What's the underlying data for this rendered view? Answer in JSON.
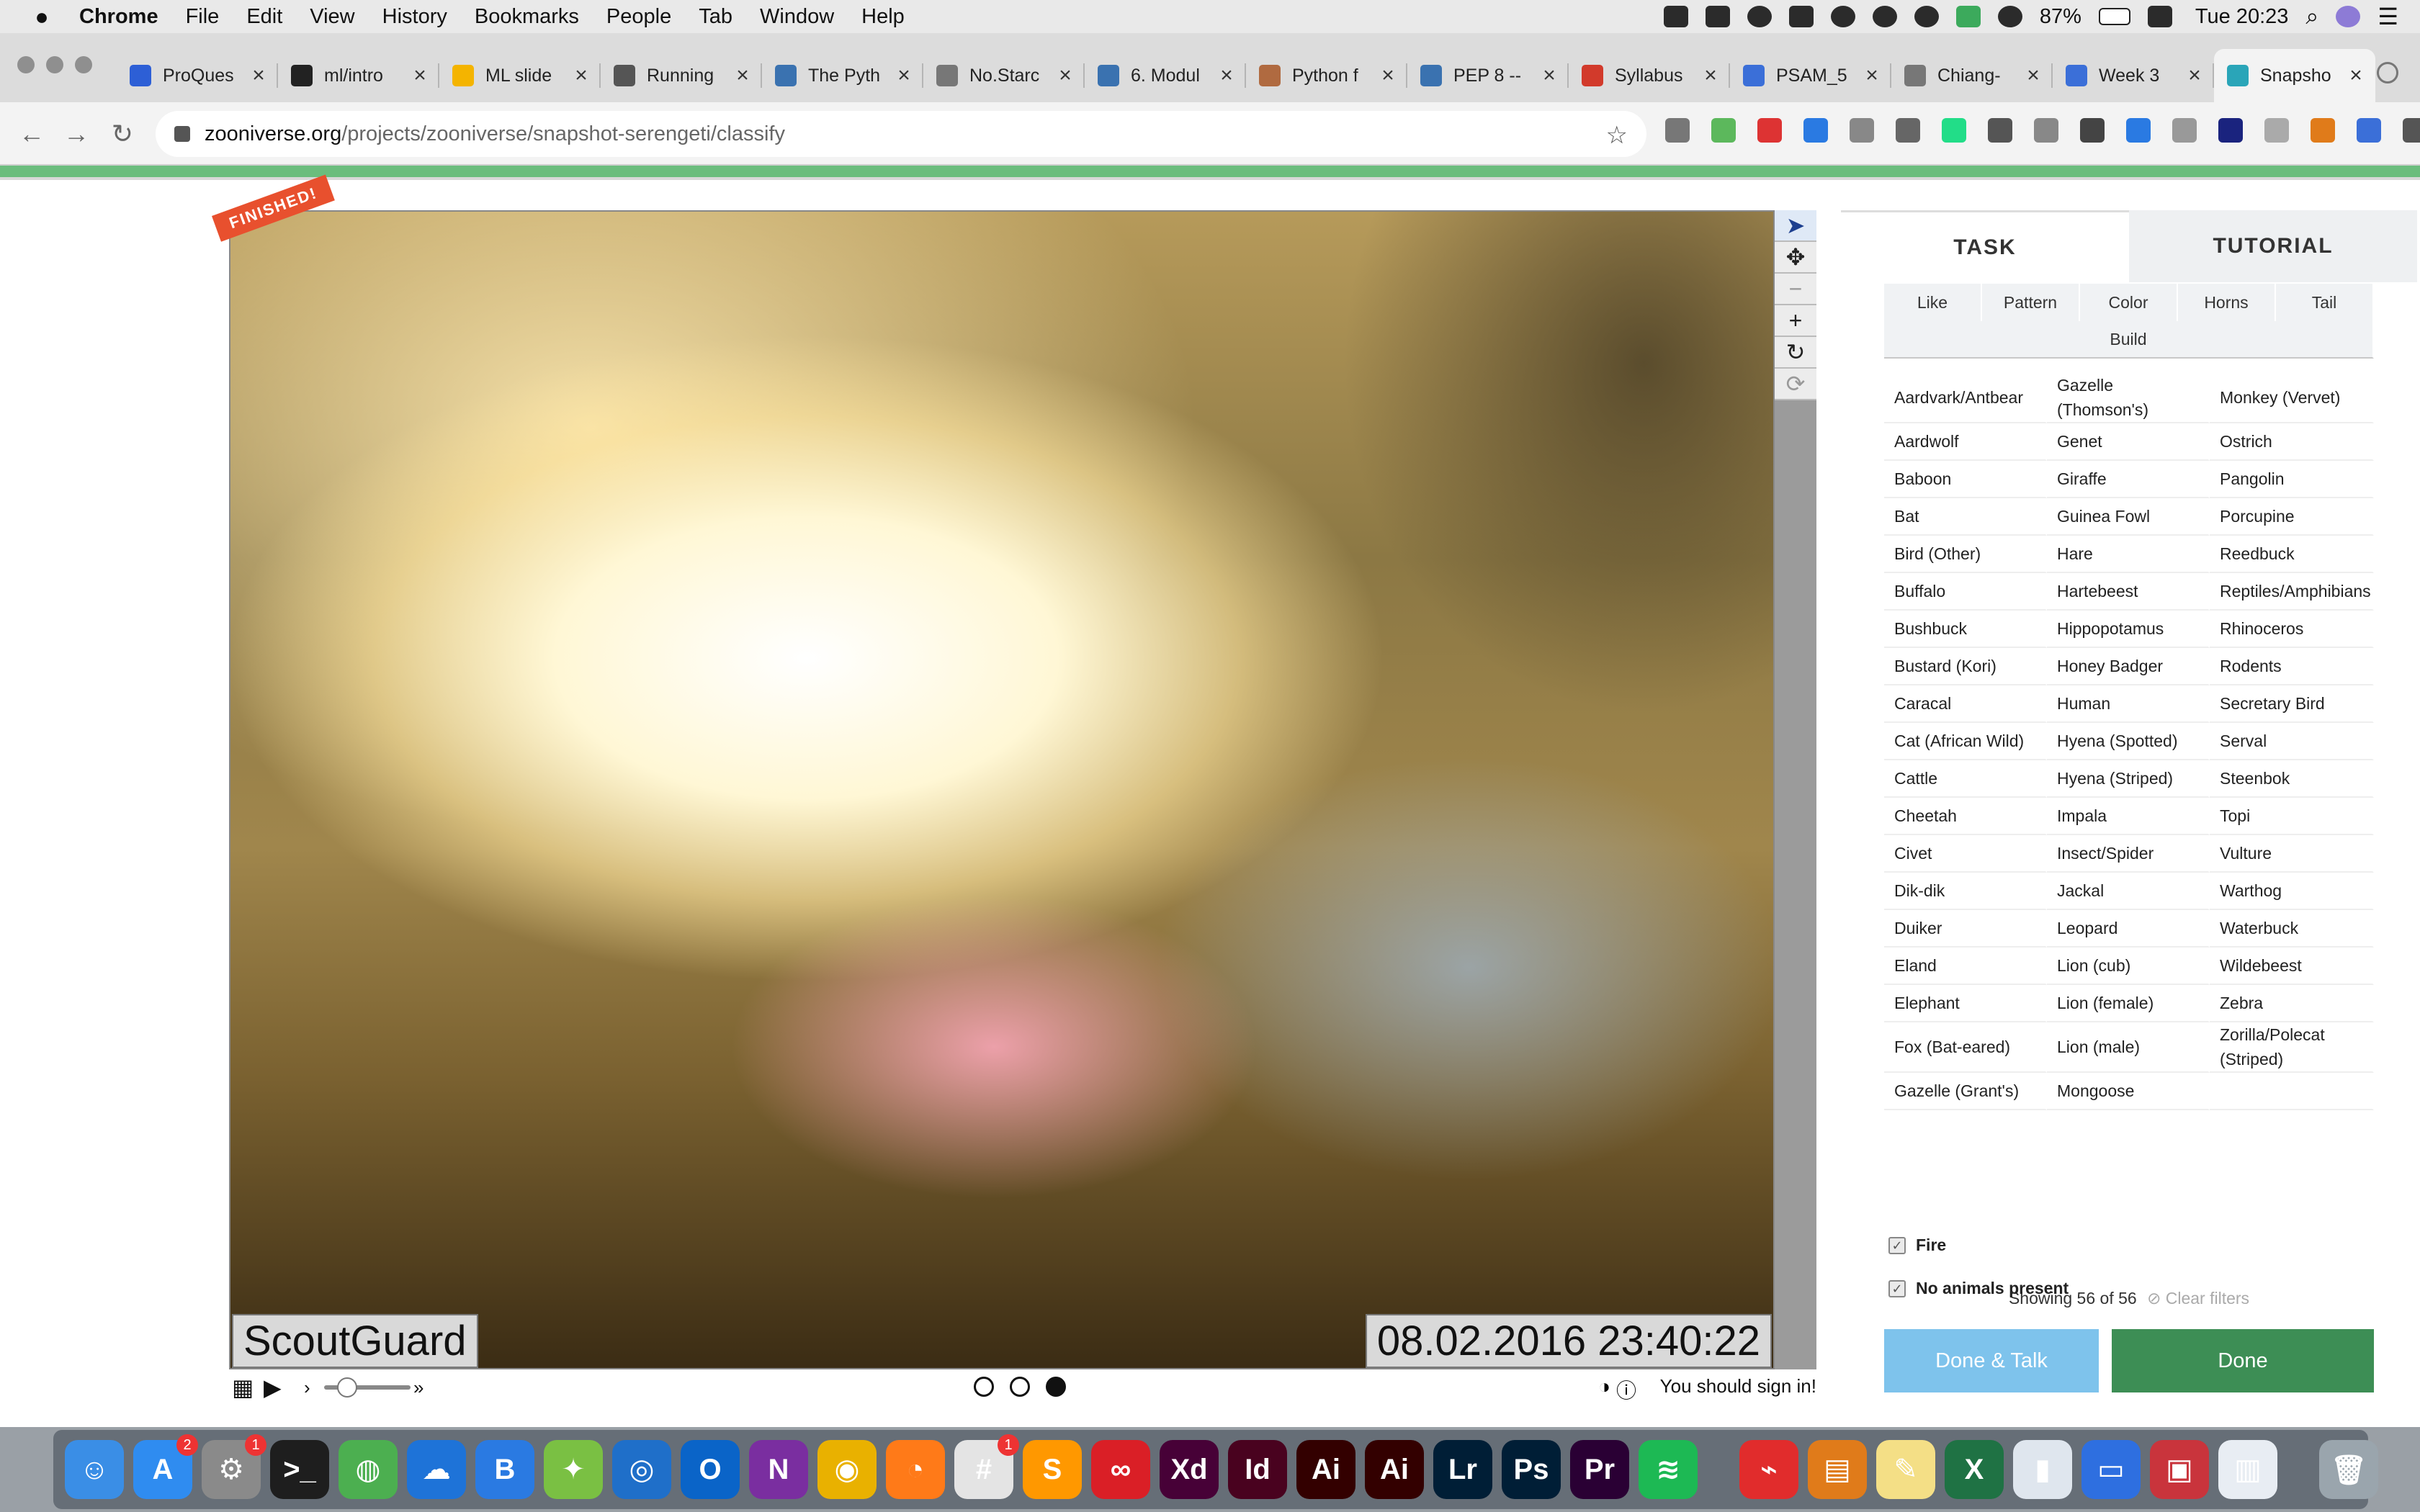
{
  "menubar": {
    "app": "Chrome",
    "items": [
      "File",
      "Edit",
      "View",
      "History",
      "Bookmarks",
      "People",
      "Tab",
      "Window",
      "Help"
    ],
    "battery": "87%",
    "clock": "Tue 20:23"
  },
  "tabs": [
    {
      "label": "ProQues",
      "color": "#2d5fd6"
    },
    {
      "label": "ml/intro",
      "color": "#222222"
    },
    {
      "label": "ML slide",
      "color": "#f4b400"
    },
    {
      "label": "Running",
      "color": "#555555"
    },
    {
      "label": "The Pyth",
      "color": "#3a72b0"
    },
    {
      "label": "No.Starc",
      "color": "#777777"
    },
    {
      "label": "6. Modul",
      "color": "#3a72b0"
    },
    {
      "label": "Python f",
      "color": "#b06a40"
    },
    {
      "label": "PEP 8 --",
      "color": "#3a72b0"
    },
    {
      "label": "Syllabus",
      "color": "#d23a2b"
    },
    {
      "label": "PSAM_5",
      "color": "#3b6fd8"
    },
    {
      "label": "Chiang-",
      "color": "#777777"
    },
    {
      "label": "Week 3",
      "color": "#3b6fd8"
    },
    {
      "label": "Snapsho",
      "color": "#2aa5b8"
    }
  ],
  "address": {
    "host": "zooniverse.org",
    "path": "/projects/zooniverse/snapshot-serengeti/classify"
  },
  "viewer": {
    "badge": "FINISHED!",
    "stamp_left": "ScoutGuard",
    "stamp_right": "08.02.2016 23:40:22",
    "signin": "You should sign in!"
  },
  "panel": {
    "tab_task": "TASK",
    "tab_tutorial": "TUTORIAL",
    "filters": [
      "Like",
      "Pattern",
      "Color",
      "Horns",
      "Tail"
    ],
    "filter_build": "Build",
    "species_col1": [
      "Aardvark/Antbear",
      "Aardwolf",
      "Baboon",
      "Bat",
      "Bird (Other)",
      "Buffalo",
      "Bushbuck",
      "Bustard (Kori)",
      "Caracal",
      "Cat (African Wild)",
      "Cattle",
      "Cheetah",
      "Civet",
      "Dik-dik",
      "Duiker",
      "Eland",
      "Elephant",
      "Fox (Bat-eared)",
      "Gazelle (Grant's)"
    ],
    "species_col2": [
      "Gazelle (Thomson's)",
      "Genet",
      "Giraffe",
      "Guinea Fowl",
      "Hare",
      "Hartebeest",
      "Hippopotamus",
      "Honey Badger",
      "Human",
      "Hyena (Spotted)",
      "Hyena (Striped)",
      "Impala",
      "Insect/Spider",
      "Jackal",
      "Leopard",
      "Lion (cub)",
      "Lion (female)",
      "Lion (male)",
      "Mongoose"
    ],
    "species_col3": [
      "Monkey (Vervet)",
      "Ostrich",
      "Pangolin",
      "Porcupine",
      "Reedbuck",
      "Reptiles/Amphibians",
      "Rhinoceros",
      "Rodents",
      "Secretary Bird",
      "Serval",
      "Steenbok",
      "Topi",
      "Vulture",
      "Warthog",
      "Waterbuck",
      "Wildebeest",
      "Zebra",
      "Zorilla/Polecat (Striped)",
      ""
    ],
    "showing": "Showing 56 of 56",
    "clear_filters": "Clear filters",
    "check_fire": "Fire",
    "check_no_animals": "No animals present",
    "btn_talk": "Done & Talk",
    "btn_done": "Done"
  },
  "dock": [
    {
      "name": "Finder",
      "label": "☺",
      "color": "#3a8ee6"
    },
    {
      "name": "App Store",
      "label": "A",
      "color": "#2f8cf0",
      "badge": "2"
    },
    {
      "name": "System Preferences",
      "label": "⚙",
      "color": "#8a8a8a",
      "badge": "1"
    },
    {
      "name": "Terminal",
      "label": ">_",
      "color": "#1e1e1e"
    },
    {
      "name": "Network",
      "label": "◍",
      "color": "#4caf50"
    },
    {
      "name": "OneDrive",
      "label": "☁",
      "color": "#1e73d8"
    },
    {
      "name": "Bluetooth",
      "label": "B",
      "color": "#2a7ae2"
    },
    {
      "name": "Tools",
      "label": "✦",
      "color": "#7ac043"
    },
    {
      "name": "Browser",
      "label": "◎",
      "color": "#1f6fc9"
    },
    {
      "name": "Outlook",
      "label": "O",
      "color": "#0a64c8"
    },
    {
      "name": "OneNote",
      "label": "N",
      "color": "#7a2ea0"
    },
    {
      "name": "Chrome",
      "label": "◉",
      "color": "#e9b100"
    },
    {
      "name": "Firefox",
      "label": "◔",
      "color": "#ff7a18"
    },
    {
      "name": "Slack",
      "label": "#",
      "color": "#e4e4e4",
      "badge": "1"
    },
    {
      "name": "Sublime",
      "label": "S",
      "color": "#ff9800"
    },
    {
      "name": "Creative Cloud",
      "label": "∞",
      "color": "#da1f26"
    },
    {
      "name": "Adobe XD",
      "label": "Xd",
      "color": "#470137"
    },
    {
      "name": "InDesign",
      "label": "Id",
      "color": "#49021f"
    },
    {
      "name": "Illustrator",
      "label": "Ai",
      "color": "#330000"
    },
    {
      "name": "Illustrator 2",
      "label": "Ai",
      "color": "#330000"
    },
    {
      "name": "Lightroom",
      "label": "Lr",
      "color": "#001e36"
    },
    {
      "name": "Photoshop",
      "label": "Ps",
      "color": "#001e36"
    },
    {
      "name": "Premiere",
      "label": "Pr",
      "color": "#2a0034"
    },
    {
      "name": "Spotify",
      "label": "≋",
      "color": "#1db954"
    },
    {
      "name": "Acrobat",
      "label": "⌁",
      "color": "#e12c2c"
    },
    {
      "name": "Books",
      "label": "▤",
      "color": "#e07b1a"
    },
    {
      "name": "Notes",
      "label": "✎",
      "color": "#f4df86"
    },
    {
      "name": "Excel",
      "label": "X",
      "color": "#1f7244"
    },
    {
      "name": "Charts",
      "label": "▮",
      "color": "#dfe6ee"
    },
    {
      "name": "Keynote",
      "label": "▭",
      "color": "#2e6fe0"
    },
    {
      "name": "Photo Booth",
      "label": "▣",
      "color": "#c9343c"
    },
    {
      "name": "Preview",
      "label": "▥",
      "color": "#e8edf3"
    },
    {
      "name": "Trash",
      "label": "🗑",
      "color": "#9aa5ad"
    }
  ]
}
